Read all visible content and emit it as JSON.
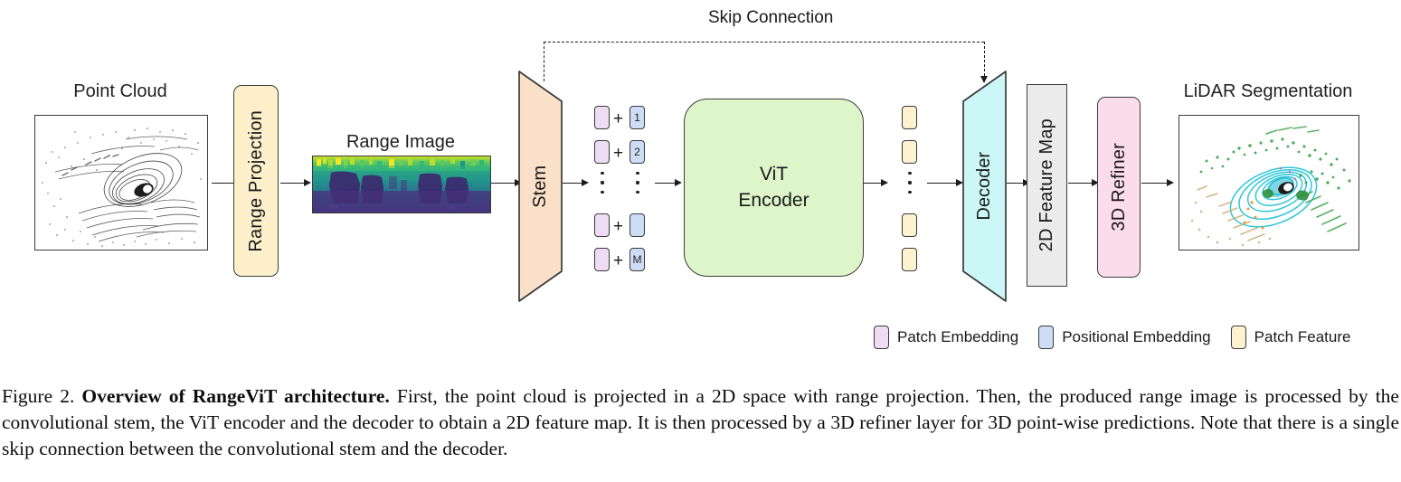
{
  "figure": {
    "skip_connection_label": "Skip Connection",
    "input": {
      "point_cloud_label": "Point Cloud",
      "range_image_label": "Range Image",
      "output_label": "LiDAR Segmentation"
    },
    "blocks": {
      "range_projection": "Range Projection",
      "stem": "Stem",
      "vit_encoder_line1": "ViT",
      "vit_encoder_line2": "Encoder",
      "decoder": "Decoder",
      "feature_map": "2D Feature Map",
      "refiner": "3D Refiner"
    },
    "tokens": {
      "positional_labels": [
        "1",
        "2",
        "",
        "M"
      ],
      "plus_symbol": "+"
    },
    "legend": [
      {
        "label": "Patch Embedding",
        "color": "#eedcf5"
      },
      {
        "label": "Positional Embedding",
        "color": "#cdddf5"
      },
      {
        "label": "Patch Feature",
        "color": "#fdf2cf"
      }
    ],
    "colors": {
      "range_projection_fill": "#fcefc9",
      "stem_fill": "#fae0c8",
      "vit_fill": "#ddf5c9",
      "decoder_fill": "#ccf7f7",
      "feature_map_fill": "#ebebeb",
      "refiner_fill": "#fbdcea",
      "patch_embedding": "#eedcf5",
      "positional_embedding": "#cdddf5",
      "patch_feature": "#fdf2cf",
      "stroke": "#3a3a3a"
    }
  },
  "caption": {
    "prefix": "Figure 2. ",
    "bold_title": "Overview of RangeViT architecture.",
    "body": " First, the point cloud is projected in a 2D space with range projection. Then, the produced range image is processed by the convolutional stem, the ViT encoder and the decoder to obtain a 2D feature map. It is then processed by a 3D refiner layer for 3D point-wise predictions. Note that there is a single skip connection between the convolutional stem and the decoder."
  }
}
